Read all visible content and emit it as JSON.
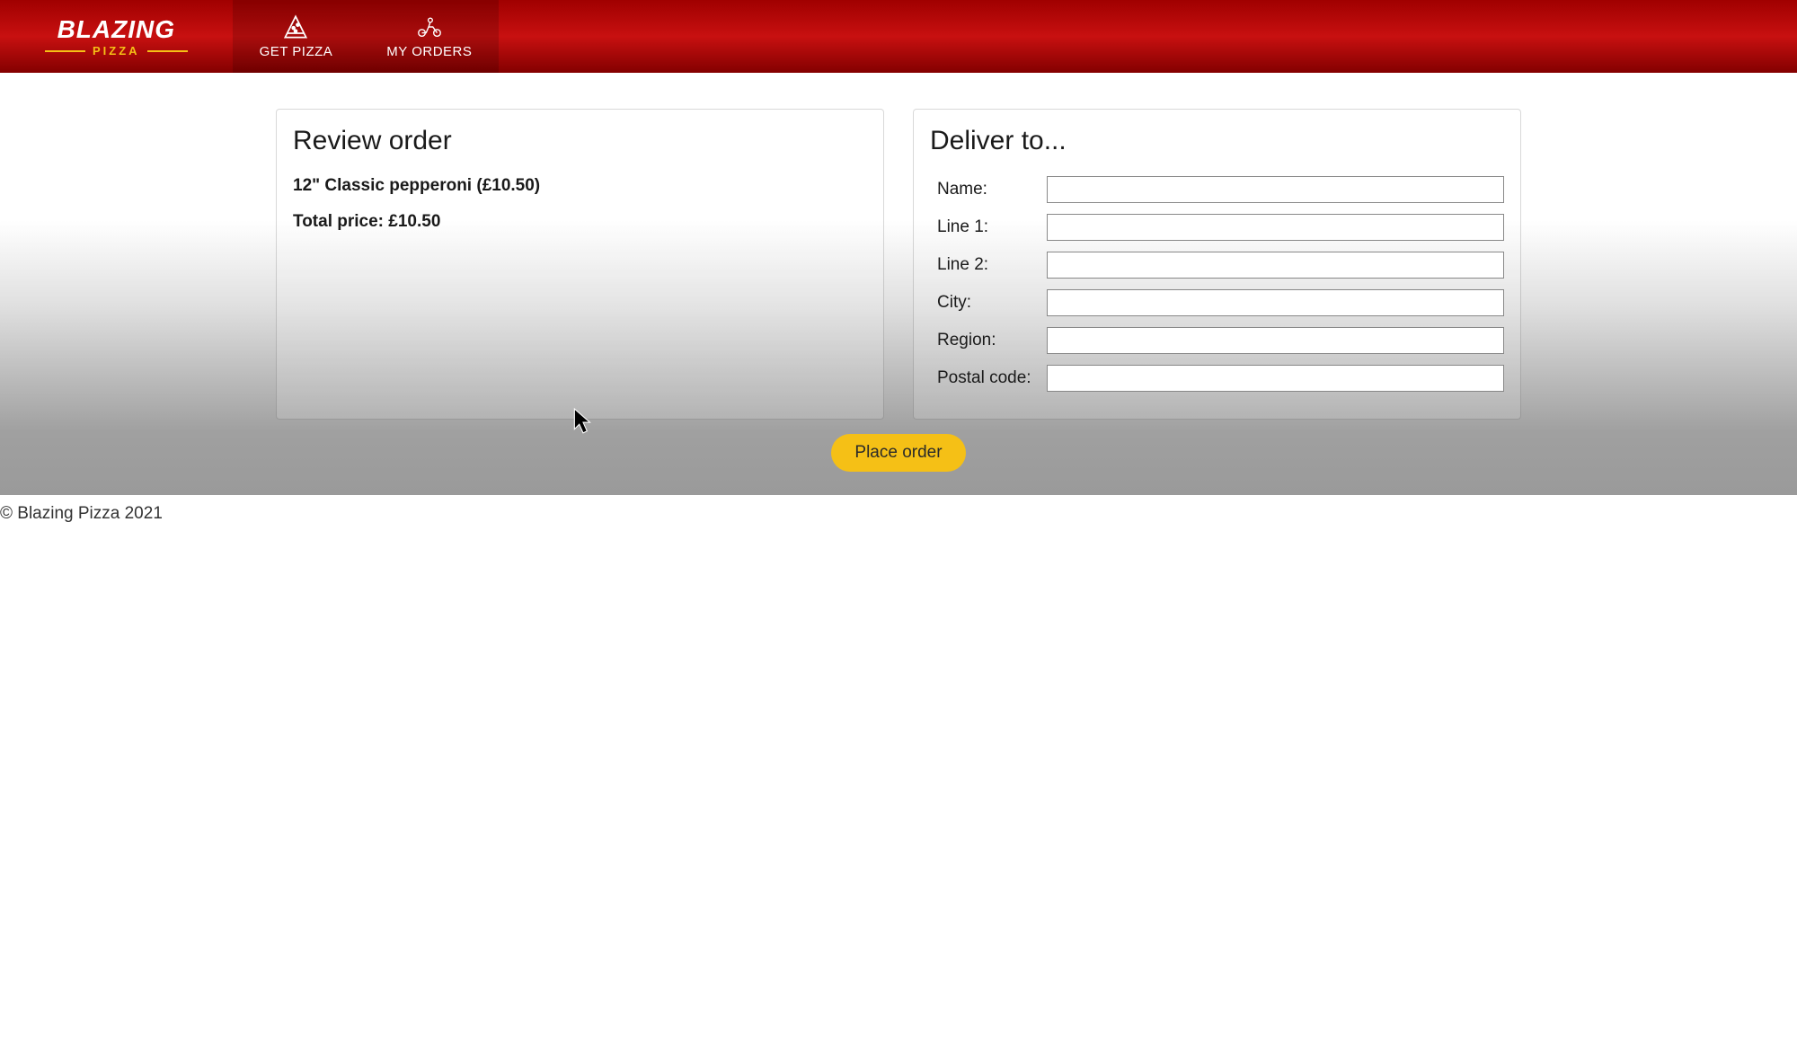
{
  "brand": {
    "top": "BLAZING",
    "bottom": "PIZZA"
  },
  "nav": {
    "get_pizza": "GET PIZZA",
    "my_orders": "MY ORDERS"
  },
  "review": {
    "title": "Review order",
    "item": "12\" Classic pepperoni (£10.50)",
    "total": "Total price: £10.50"
  },
  "delivery": {
    "title": "Deliver to...",
    "fields": {
      "name": {
        "label": "Name:",
        "value": ""
      },
      "line1": {
        "label": "Line 1:",
        "value": ""
      },
      "line2": {
        "label": "Line 2:",
        "value": ""
      },
      "city": {
        "label": "City:",
        "value": ""
      },
      "region": {
        "label": "Region:",
        "value": ""
      },
      "postal": {
        "label": "Postal code:",
        "value": ""
      }
    }
  },
  "actions": {
    "place_order": "Place order"
  },
  "footer": {
    "copyright": "© Blazing Pizza 2021"
  }
}
